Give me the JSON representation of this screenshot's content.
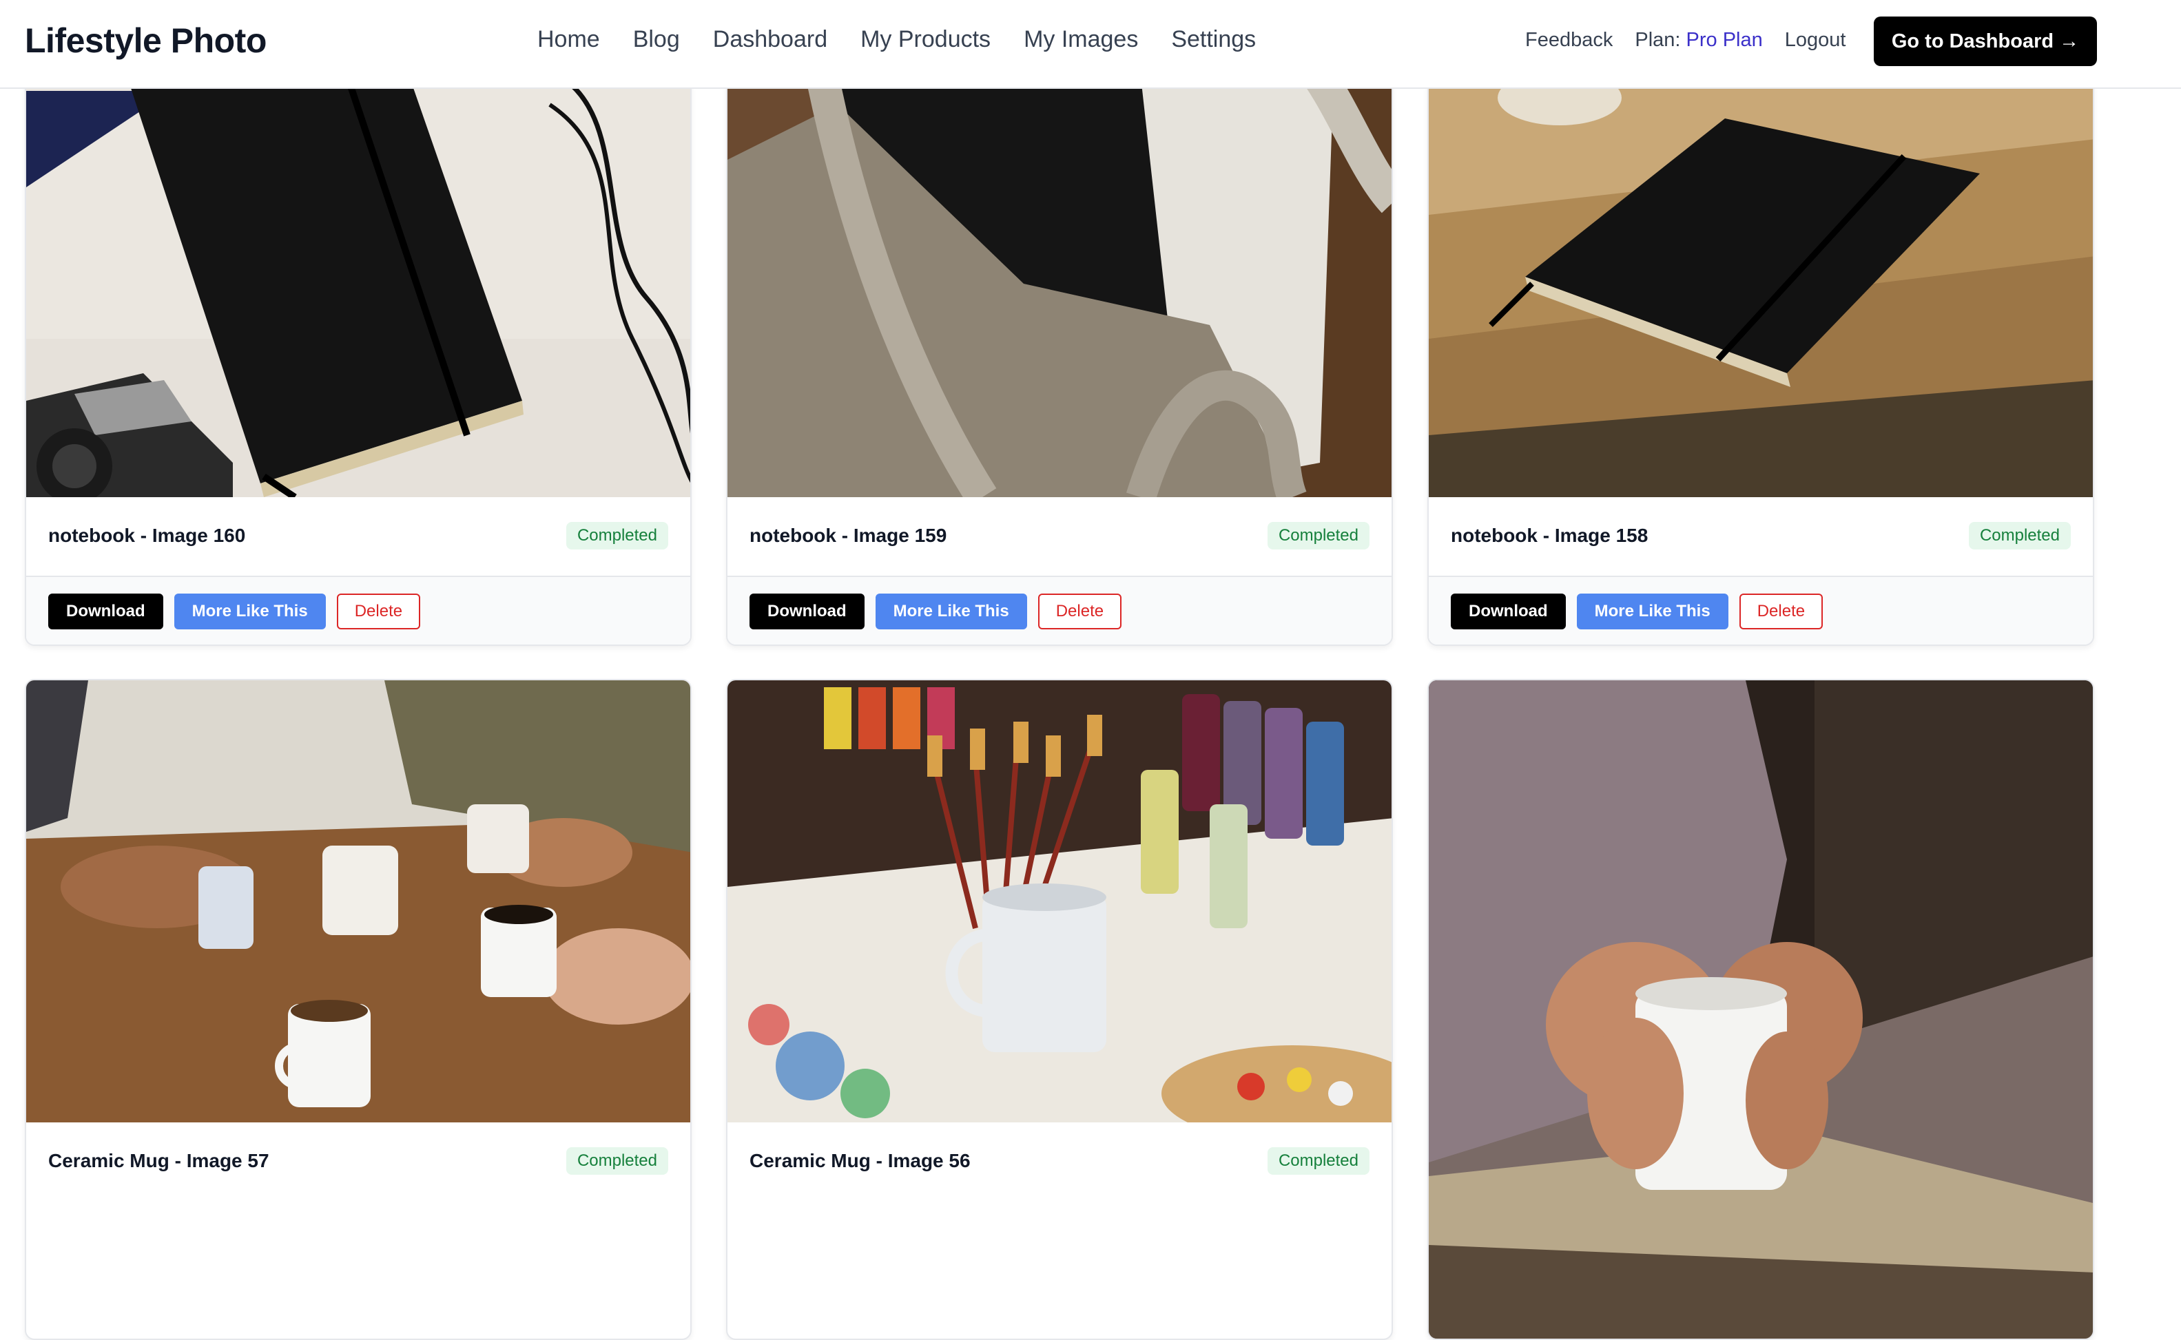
{
  "app": {
    "brand": "Lifestyle Photo"
  },
  "nav": {
    "items": [
      "Home",
      "Blog",
      "Dashboard",
      "My Products",
      "My Images",
      "Settings"
    ]
  },
  "account": {
    "feedback": "Feedback",
    "plan_label": "Plan:",
    "plan_value": "Pro Plan",
    "logout": "Logout",
    "cta": "Go to Dashboard →"
  },
  "colors": {
    "primary": "#000000",
    "accent_blue": "#4f86f0",
    "plan_link": "#3b30c9",
    "delete_red": "#dc2626",
    "badge_green": "#16803c"
  },
  "cards": [
    {
      "title": "notebook - Image 160",
      "status": "Completed",
      "download": "Download",
      "more": "More Like This",
      "delete": "Delete"
    },
    {
      "title": "notebook - Image 159",
      "status": "Completed",
      "download": "Download",
      "more": "More Like This",
      "delete": "Delete"
    },
    {
      "title": "notebook - Image 158",
      "status": "Completed",
      "download": "Download",
      "more": "More Like This",
      "delete": "Delete"
    },
    {
      "title": "Ceramic Mug - Image 57",
      "status": "Completed"
    },
    {
      "title": "Ceramic Mug - Image 56",
      "status": "Completed"
    }
  ]
}
